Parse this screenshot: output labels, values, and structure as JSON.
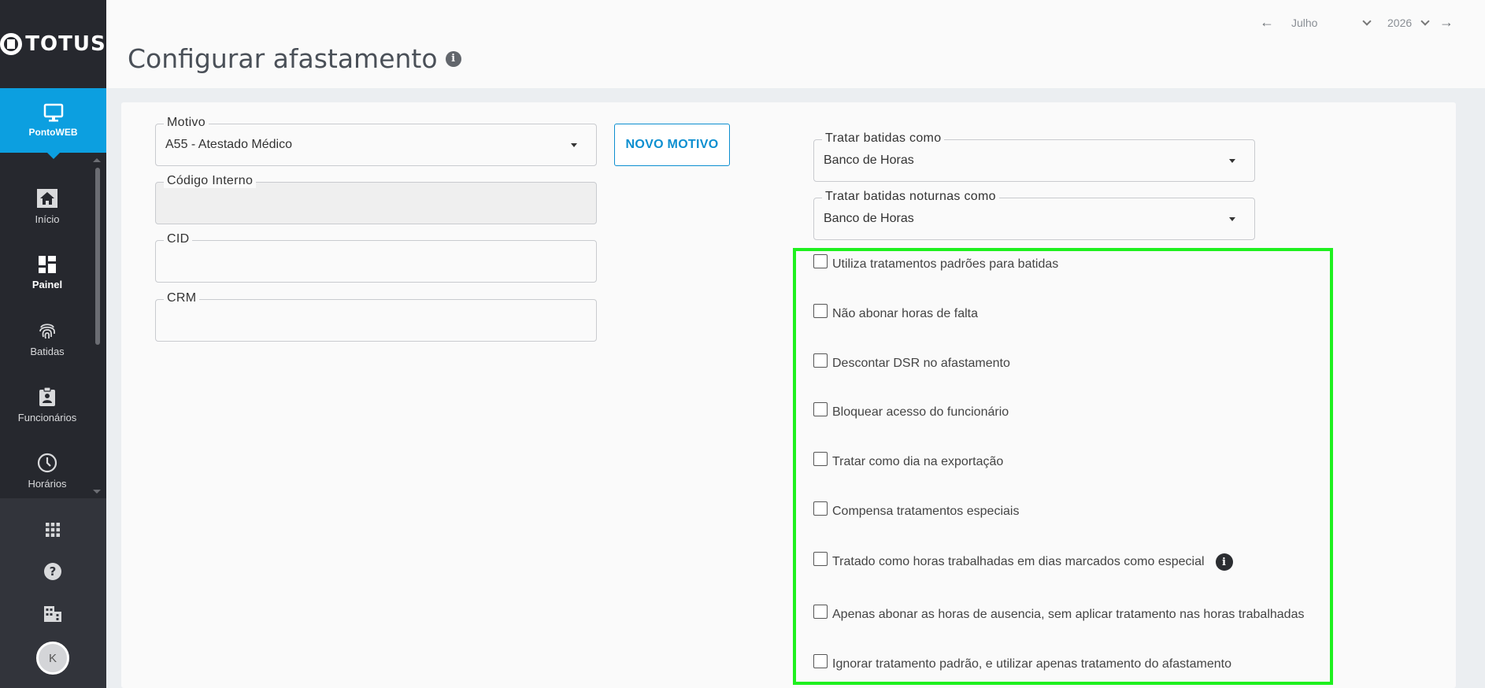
{
  "app": {
    "logo_text": "TOTUS"
  },
  "sidebar": {
    "active": {
      "label": "PontoWEB",
      "icon": "monitor-icon"
    },
    "items": [
      {
        "label": "Início",
        "icon": "home-icon"
      },
      {
        "label": "Painel",
        "icon": "dashboard-icon"
      },
      {
        "label": "Batidas",
        "icon": "fingerprint-icon"
      },
      {
        "label": "Funcionários",
        "icon": "badge-icon"
      },
      {
        "label": "Horários",
        "icon": "clock-icon"
      }
    ],
    "bottom": [
      {
        "icon": "apps-grid-icon"
      },
      {
        "icon": "help-icon"
      },
      {
        "icon": "building-icon"
      }
    ],
    "avatar_initial": "K"
  },
  "header": {
    "title": "Configurar afastamento",
    "month": "Julho",
    "year": "2026"
  },
  "form": {
    "motivo": {
      "label": "Motivo",
      "value": "A55 - Atestado Médico"
    },
    "codigo_interno": {
      "label": "Código Interno",
      "value": ""
    },
    "cid": {
      "label": "CID",
      "value": ""
    },
    "crm": {
      "label": "CRM",
      "value": ""
    },
    "novo_motivo_label": "NOVO MOTIVO",
    "tratar_batidas": {
      "label": "Tratar batidas como",
      "value": "Banco de Horas"
    },
    "tratar_noturnas": {
      "label": "Tratar batidas noturnas como",
      "value": "Banco de Horas"
    }
  },
  "options": [
    {
      "label": "Utiliza tratamentos padrões para batidas",
      "checked": false
    },
    {
      "label": "Não abonar horas de falta",
      "checked": false
    },
    {
      "label": "Descontar DSR no afastamento",
      "checked": false
    },
    {
      "label": "Bloquear acesso do funcionário",
      "checked": false
    },
    {
      "label": "Tratar como dia na exportação",
      "checked": false
    },
    {
      "label": "Compensa tratamentos especiais",
      "checked": false
    },
    {
      "label": "Tratado como horas trabalhadas em dias marcados como especial",
      "checked": false
    },
    {
      "label": "Apenas abonar as horas de ausencia, sem aplicar tratamento nas horas trabalhadas",
      "checked": false
    },
    {
      "label": "Ignorar tratamento padrão, e utilizar apenas tratamento do afastamento",
      "checked": false
    }
  ],
  "colors": {
    "accent": "#0c9fe0",
    "sidebar": "#26282e",
    "highlight": "#1ef01e"
  }
}
